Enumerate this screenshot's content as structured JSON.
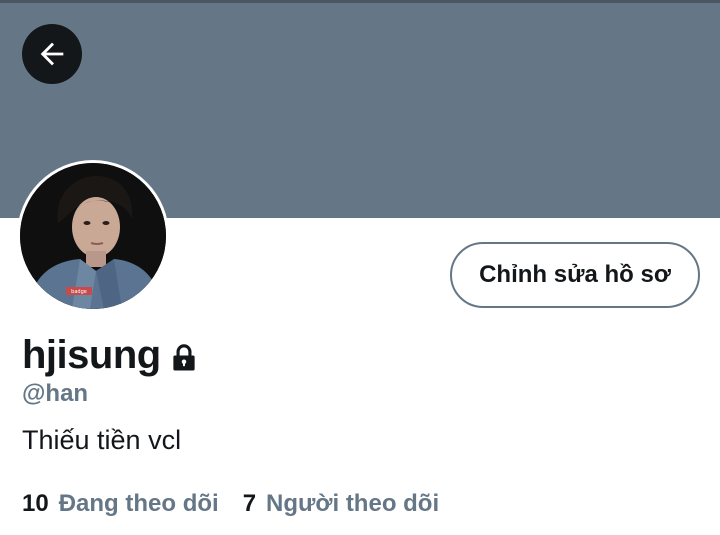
{
  "profile": {
    "display_name": "hjisung",
    "handle": "@han",
    "bio": "Thiếu tiền vcl",
    "edit_button_label": "Chỉnh sửa hồ sơ",
    "following_count": "10",
    "following_label": "Đang theo dõi",
    "followers_count": "7",
    "followers_label": "Người theo dõi"
  },
  "icons": {
    "back": "arrow-left-icon",
    "lock": "lock-icon"
  },
  "colors": {
    "banner": "#657786",
    "text_primary": "#14171a",
    "text_secondary": "#657786",
    "button_border": "#657786"
  }
}
